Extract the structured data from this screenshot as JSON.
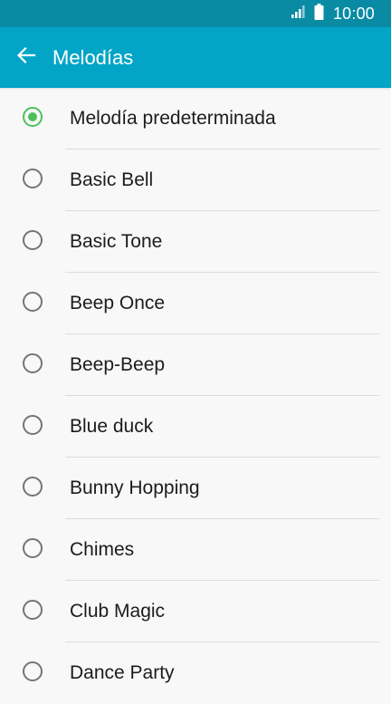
{
  "status_bar": {
    "time": "10:00",
    "icons": [
      "signal-icon",
      "battery-icon"
    ]
  },
  "app_bar": {
    "back_icon": "arrow-left-icon",
    "title": "Melodías"
  },
  "colors": {
    "status_bar": "#0a8ba4",
    "app_bar": "#03a5c6",
    "radio_checked": "#4fbf5c",
    "radio_unchecked": "#757575",
    "background": "#f8f8f8"
  },
  "ringtones": {
    "selected_index": 0,
    "items": [
      {
        "label": "Melodía predeterminada",
        "selected": true
      },
      {
        "label": "Basic Bell",
        "selected": false
      },
      {
        "label": "Basic Tone",
        "selected": false
      },
      {
        "label": "Beep Once",
        "selected": false
      },
      {
        "label": "Beep-Beep",
        "selected": false
      },
      {
        "label": "Blue duck",
        "selected": false
      },
      {
        "label": "Bunny Hopping",
        "selected": false
      },
      {
        "label": "Chimes",
        "selected": false
      },
      {
        "label": "Club Magic",
        "selected": false
      },
      {
        "label": "Dance Party",
        "selected": false
      }
    ]
  }
}
